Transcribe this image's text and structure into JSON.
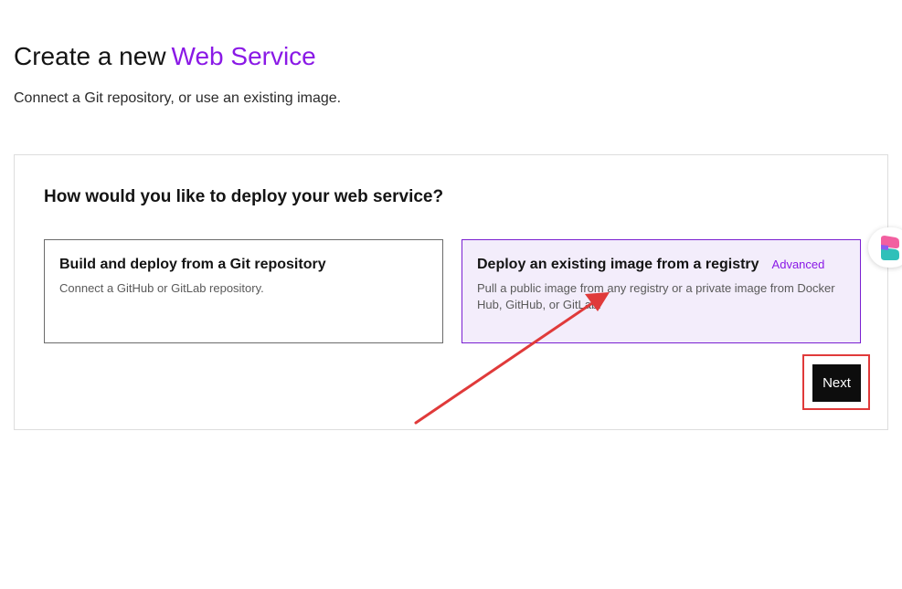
{
  "header": {
    "title_prefix": "Create a new",
    "title_accent": "Web Service",
    "subtitle": "Connect a Git repository, or use an existing image."
  },
  "deploy_panel": {
    "heading": "How would you like to deploy your web service?",
    "options": [
      {
        "title": "Build and deploy from a Git repository",
        "description": "Connect a GitHub or GitLab repository.",
        "selected": false
      },
      {
        "title": "Deploy an existing image from a registry",
        "badge": "Advanced",
        "description": "Pull a public image from any registry or a private image from Docker Hub, GitHub, or GitLab.",
        "selected": true
      }
    ],
    "next_label": "Next"
  },
  "colors": {
    "accent": "#8a19e6",
    "selected_border": "#7a1fd1",
    "selected_background": "#f3edfb",
    "annotation_red": "#e03a3a",
    "button_background": "#0d0d0d"
  },
  "icons": {
    "extension_widget": "browser-extension-icon",
    "annotation": "red-arrow-annotation"
  }
}
